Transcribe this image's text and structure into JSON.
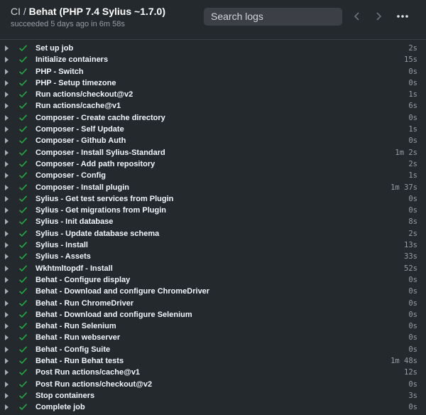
{
  "header": {
    "breadcrumb": "CI",
    "separator": "/",
    "job_title": "Behat (PHP 7.4 Sylius ~1.7.0)",
    "status": "succeeded 5 days ago in 6m 58s",
    "search_placeholder": "Search logs"
  },
  "icons": {
    "prev": "chevron-left-icon",
    "next": "chevron-right-icon",
    "more": "kebab-horizontal-icon",
    "expand": "triangle-right-icon",
    "success": "check-icon"
  },
  "colors": {
    "background": "#24292e",
    "success": "#28a745",
    "text": "#f0f6fc",
    "muted": "#959da5"
  },
  "steps": [
    {
      "name": "Set up job",
      "duration": "2s"
    },
    {
      "name": "Initialize containers",
      "duration": "15s"
    },
    {
      "name": "PHP - Switch",
      "duration": "0s"
    },
    {
      "name": "PHP - Setup timezone",
      "duration": "0s"
    },
    {
      "name": "Run actions/checkout@v2",
      "duration": "1s"
    },
    {
      "name": "Run actions/cache@v1",
      "duration": "6s"
    },
    {
      "name": "Composer - Create cache directory",
      "duration": "0s"
    },
    {
      "name": "Composer - Self Update",
      "duration": "1s"
    },
    {
      "name": "Composer - Github Auth",
      "duration": "0s"
    },
    {
      "name": "Composer - Install Sylius-Standard",
      "duration": "1m 2s"
    },
    {
      "name": "Composer - Add path repository",
      "duration": "2s"
    },
    {
      "name": "Composer - Config",
      "duration": "1s"
    },
    {
      "name": "Composer - Install plugin",
      "duration": "1m 37s"
    },
    {
      "name": "Sylius - Get test services from Plugin",
      "duration": "0s"
    },
    {
      "name": "Sylius - Get migrations from Plugin",
      "duration": "0s"
    },
    {
      "name": "Sylius - Init database",
      "duration": "8s"
    },
    {
      "name": "Sylius - Update database schema",
      "duration": "2s"
    },
    {
      "name": "Sylius - Install",
      "duration": "13s"
    },
    {
      "name": "Sylius - Assets",
      "duration": "33s"
    },
    {
      "name": "Wkhtmltopdf - Install",
      "duration": "52s"
    },
    {
      "name": "Behat - Configure display",
      "duration": "0s"
    },
    {
      "name": "Behat - Download and configure ChromeDriver",
      "duration": "0s"
    },
    {
      "name": "Behat - Run ChromeDriver",
      "duration": "0s"
    },
    {
      "name": "Behat - Download and configure Selenium",
      "duration": "0s"
    },
    {
      "name": "Behat - Run Selenium",
      "duration": "0s"
    },
    {
      "name": "Behat - Run webserver",
      "duration": "0s"
    },
    {
      "name": "Behat - Config Suite",
      "duration": "0s"
    },
    {
      "name": "Behat - Run Behat tests",
      "duration": "1m 48s"
    },
    {
      "name": "Post Run actions/cache@v1",
      "duration": "12s"
    },
    {
      "name": "Post Run actions/checkout@v2",
      "duration": "0s"
    },
    {
      "name": "Stop containers",
      "duration": "3s"
    },
    {
      "name": "Complete job",
      "duration": "0s"
    }
  ]
}
